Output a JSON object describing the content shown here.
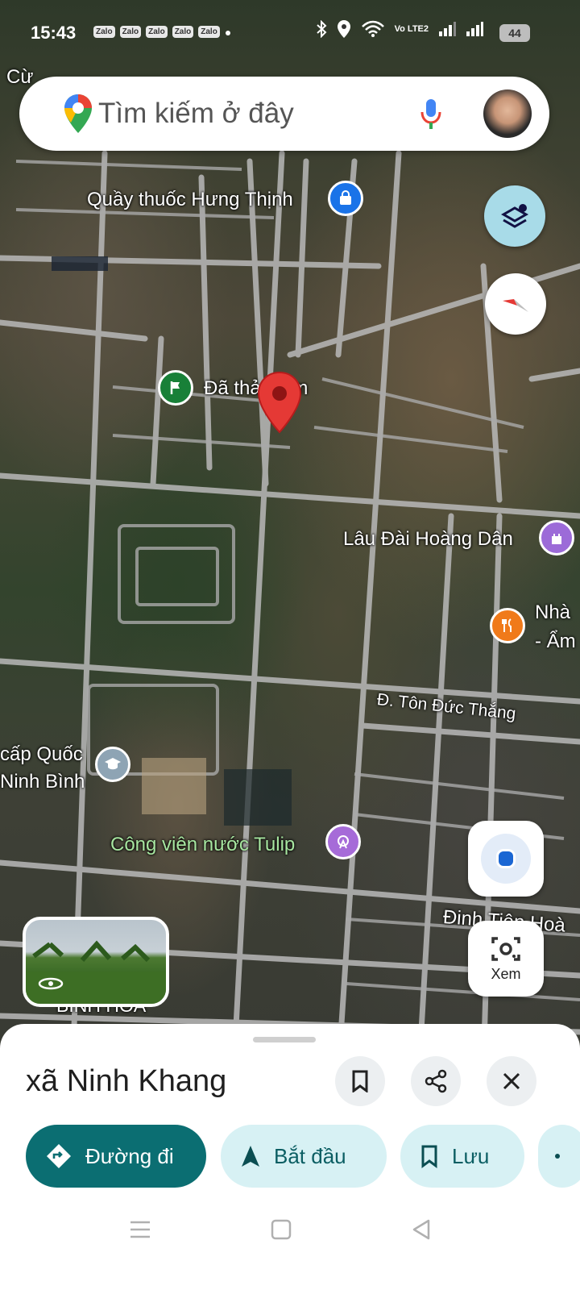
{
  "status_bar": {
    "time": "15:43",
    "app_badges": [
      "Zalo",
      "Zalo",
      "Zalo",
      "Zalo",
      "Zalo"
    ],
    "network": "Vo LTE2",
    "battery": "44"
  },
  "search": {
    "placeholder": "Tìm kiếm ở đây"
  },
  "map_labels": {
    "city_partial": "Cừ",
    "pharmacy": "Quầy thuốc Hưng Thịnh",
    "flag_place": "Đã thả ghim",
    "castle": "Lâu Đài Hoàng Dân",
    "restaurant_partial_1": "Nhà",
    "restaurant_partial_2": "- Ẩm",
    "street_ton_duc_thang": "Đ. Tôn Đức Thắng",
    "school_line1": "cấp Quốc",
    "school_line2": "Ninh Bình",
    "water_park": "Công viên nước Tulip",
    "street_dinh_tien_hoang": "Đinh Tiên Hoà",
    "district": "BÌNH HÒA"
  },
  "view_button": {
    "label": "Xem"
  },
  "bottom_sheet": {
    "place_name": "xã Ninh Khang",
    "actions": {
      "directions": "Đường đi",
      "start": "Bắt đầu",
      "save": "Lưu"
    }
  },
  "icons": {
    "maps_pin": "google-maps-pin-icon",
    "mic": "mic-icon",
    "layers": "layers-icon",
    "compass": "compass-icon",
    "location": "my-location-icon",
    "lens": "lens-icon",
    "bookmark": "bookmark-icon",
    "share": "share-icon",
    "close": "close-icon"
  },
  "colors": {
    "primary": "#0b6e72",
    "secondary_chip": "#d7f1f4",
    "pin_red": "#e53935"
  }
}
